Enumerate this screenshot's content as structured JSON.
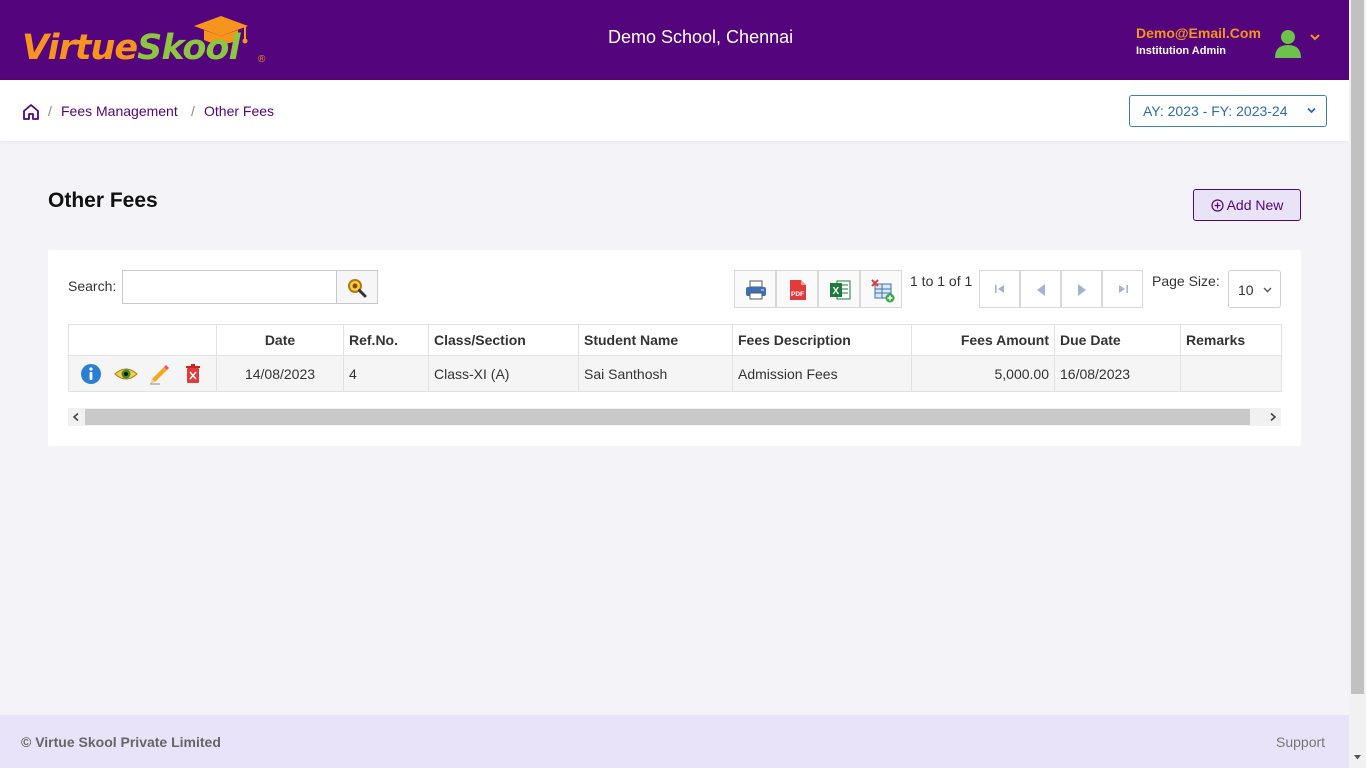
{
  "brand": {
    "logo_part1": "Virtue",
    "logo_part2": "Skool",
    "registered": "®",
    "school_name": "Demo School, Chennai",
    "primary_color": "#54047c",
    "accent_orange": "#f7941d",
    "accent_green": "#8dc63f"
  },
  "user": {
    "email": "Demo@Email.Com",
    "role": "Institution Admin",
    "avatar_icon": "user-icon",
    "menu_icon": "chevron-down-icon"
  },
  "breadcrumb": {
    "home_icon": "home-icon",
    "items": [
      "Fees Management",
      "Other Fees"
    ],
    "separator": "/"
  },
  "academic_year": {
    "label": "AY: 2023 - FY: 2023-24"
  },
  "page": {
    "title": "Other Fees",
    "add_new_label": "Add New"
  },
  "toolbar": {
    "search_label": "Search:",
    "search_value": "",
    "search_icon": "search-icon",
    "export_icons": [
      "print-icon",
      "pdf-icon",
      "excel-icon",
      "clear-filter-icon"
    ],
    "pager_text": "1 to 1 of 1",
    "pager_icons": [
      "first-page-icon",
      "previous-page-icon",
      "next-page-icon",
      "last-page-icon"
    ],
    "page_size_label": "Page Size:",
    "page_size_value": "10"
  },
  "table": {
    "columns": [
      "",
      "Date",
      "Ref.No.",
      "Class/Section",
      "Student Name",
      "Fees Description",
      "Fees Amount",
      "Due Date",
      "Remarks"
    ],
    "row_action_icons": [
      "info-icon",
      "view-icon",
      "edit-icon",
      "delete-icon"
    ],
    "rows": [
      {
        "date": "14/08/2023",
        "ref_no": "4",
        "class_section": "Class-XI (A)",
        "student_name": "Sai Santhosh",
        "fees_description": "Admission Fees",
        "fees_amount": "5,000.00",
        "due_date": "16/08/2023",
        "remarks": ""
      }
    ]
  },
  "footer": {
    "copyright": "© Virtue Skool Private Limited",
    "support": "Support"
  }
}
